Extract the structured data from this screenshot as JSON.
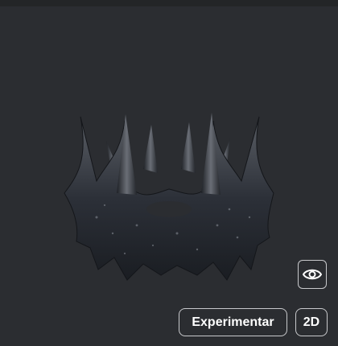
{
  "item_viewer": {
    "model_name": "crown-3d-model",
    "controls": {
      "visibility_icon": "eye-icon",
      "try_on_label": "Experimentar",
      "view_2d_label": "2D"
    }
  },
  "colors": {
    "background": "#2b2d31",
    "button_border": "#c8c9cc",
    "button_text": "#ffffff"
  }
}
